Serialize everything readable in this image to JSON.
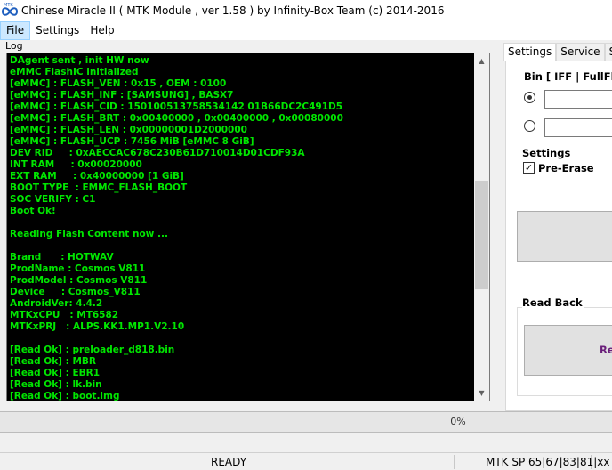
{
  "window": {
    "title": "Chinese Miracle II ( MTK Module , ver 1.58 ) by Infinity-Box Team (c) 2014-2016",
    "icon_text": "MTK"
  },
  "menu": {
    "items": [
      "File",
      "Settings",
      "Help"
    ]
  },
  "log": {
    "label": "Log",
    "lines": [
      "DAgent sent , init HW now",
      "eMMC FlashIC initialized",
      "[eMMC] : FLASH_VEN : 0x15 , OEM : 0100",
      "[eMMC] : FLASH_INF : [SAMSUNG] , BASX7",
      "[eMMC] : FLASH_CID : 150100513758534142 01B66DC2C491D5",
      "[eMMC] : FLASH_BRT : 0x00400000 , 0x00400000 , 0x00080000",
      "[eMMC] : FLASH_LEN : 0x00000001D2000000",
      "[eMMC] : FLASH_UCP : 7456 MiB [eMMC 8 GiB]",
      "DEV RID     : 0xAECCAC678C230B61D710014D01CDF93A",
      "INT RAM     : 0x00020000",
      "EXT RAM     : 0x40000000 [1 GiB]",
      "BOOT TYPE  : EMMC_FLASH_BOOT",
      "SOC VERIFY : C1",
      "Boot Ok!",
      "",
      "Reading Flash Content now ...",
      "",
      "Brand      : HOTWAV",
      "ProdName : Cosmos V811",
      "ProdModel : Cosmos V811",
      "Device     : Cosmos_V811",
      "AndroidVer: 4.4.2",
      "MTKxCPU   : MT6582",
      "MTKxPRJ   : ALPS.KK1.MP1.V2.10",
      "",
      "[Read Ok] : preloader_d818.bin",
      "[Read Ok] : MBR",
      "[Read Ok] : EBR1",
      "[Read Ok] : lk.bin",
      "[Read Ok] : boot.img"
    ],
    "text_color": "#00e600",
    "background": "#000000"
  },
  "right_panel": {
    "tabs": [
      "Settings",
      "Service",
      "Se"
    ],
    "active_tab": "Settings",
    "bin_label": "Bin  [ IFF | FullFlas",
    "settings_title": "Settings",
    "pre_erase_label": "Pre-Erase",
    "pre_erase_checked": true,
    "read_back_title": "Read Back",
    "read_back_button_text": "Re"
  },
  "progress": {
    "text": "0%",
    "value": 0
  },
  "status": {
    "state": "READY",
    "mtk_info": "MTK SP 65|67|83|81|xx"
  }
}
